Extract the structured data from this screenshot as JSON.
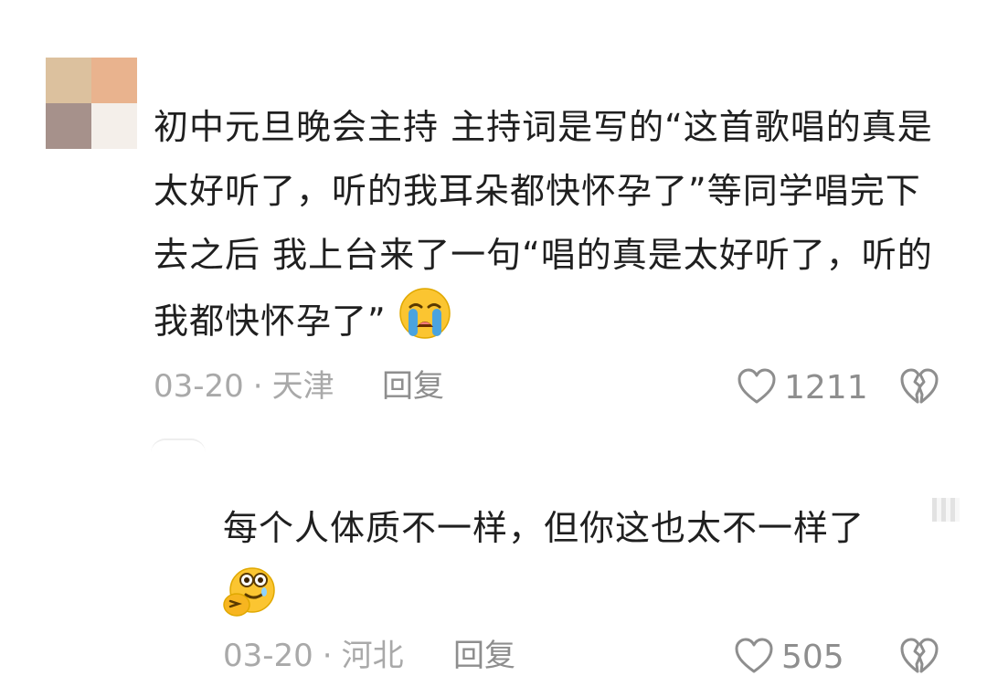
{
  "comments": [
    {
      "text": "初中元旦晚会主持 主持词是写的“这首歌唱的真是太好听了，听的我耳朵都快怀孕了”等同学唱完下去之后 我上台来了一句“唱的真是太好听了，听的我都快怀孕了”",
      "emoji": "crying-emoji",
      "date": "03-20",
      "location": "天津",
      "separator": "·",
      "reply_label": "回复",
      "likes": "1211"
    },
    {
      "text": "每个人体质不一样，但你这也太不一样了",
      "emoji": "drooling-thinking-emoji",
      "date": "03-20",
      "location": "河北",
      "separator": "·",
      "reply_label": "回复",
      "likes": "505"
    }
  ],
  "colors": {
    "text": "#1f1f1f",
    "meta": "#a9a9a9",
    "icon": "#8e8e8e",
    "emoji_yellow": "#fbc531",
    "tear_blue": "#4aa3df"
  }
}
